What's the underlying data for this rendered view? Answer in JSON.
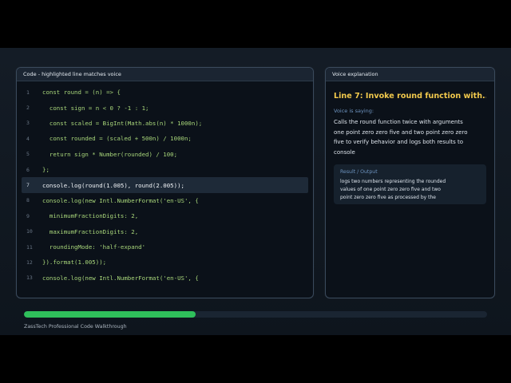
{
  "code_panel": {
    "title": "Code - highlighted line matches voice",
    "active_line": 7,
    "lines": [
      {
        "num": "1",
        "text": "const round = (n) => {"
      },
      {
        "num": "2",
        "text": "  const sign = n < 0 ? -1 : 1;"
      },
      {
        "num": "3",
        "text": "  const scaled = BigInt(Math.abs(n) * 1000n);"
      },
      {
        "num": "4",
        "text": "  const rounded = (scaled + 500n) / 1000n;"
      },
      {
        "num": "5",
        "text": "  return sign * Number(rounded) / 100;"
      },
      {
        "num": "6",
        "text": "};"
      },
      {
        "num": "7",
        "text": "console.log(round(1.005), round(2.005));"
      },
      {
        "num": "8",
        "text": "console.log(new Intl.NumberFormat('en-US', {"
      },
      {
        "num": "9",
        "text": "  minimumFractionDigits: 2,"
      },
      {
        "num": "10",
        "text": "  maximumFractionDigits: 2,"
      },
      {
        "num": "11",
        "text": "  roundingMode: 'half-expand'"
      },
      {
        "num": "12",
        "text": "}).format(1.005));"
      },
      {
        "num": "13",
        "text": "console.log(new Intl.NumberFormat('en-US', {"
      }
    ]
  },
  "voice_panel": {
    "title": "Voice explanation",
    "line_title": "Line 7: Invoke round function with...",
    "saying_label": "Voice is saying:",
    "saying_text": "Calls the round function twice with arguments one point zero zero five and two point zero zero five to verify behavior and logs both results to console",
    "result_label": "Result / Output",
    "result_text": "logs two numbers representing the rounded values of one point zero zero five and two point zero zero five as processed by the"
  },
  "progress": {
    "fraction": 0.37
  },
  "footer": {
    "text": "ZassTech Professional Code Walkthrough"
  },
  "colors": {
    "code_text": "#a8d67a",
    "title_accent": "#f2c94c",
    "progress_fill": "#2fbf5b",
    "label_blue": "#6d93bf"
  }
}
